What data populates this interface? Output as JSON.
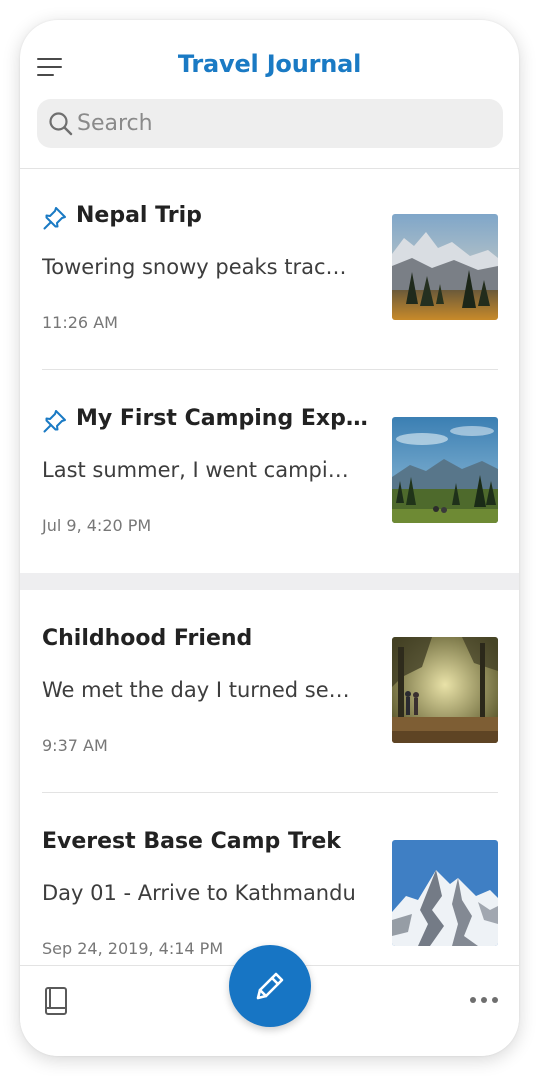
{
  "header": {
    "title": "Travel Journal",
    "search_placeholder": "Search"
  },
  "entries": [
    {
      "title": "Nepal Trip",
      "snippet": "Towering snowy peaks trac…",
      "time": "11:26 AM",
      "pinned": true,
      "thumbnail": "mountain-sunset-forest-image"
    },
    {
      "title": "My First Camping Expe…",
      "snippet": "Last summer, I went campi…",
      "time": "Jul 9, 4:20 PM",
      "pinned": true,
      "thumbnail": "campsite-mountains-image"
    },
    {
      "title": "Childhood Friend",
      "snippet": "We met the day I turned se…",
      "time": "9:37 AM",
      "pinned": false,
      "thumbnail": "forest-path-walkers-image"
    },
    {
      "title": "Everest Base Camp Trek",
      "snippet": "Day 01 - Arrive to Kathmandu",
      "time": "Sep 24, 2019, 4:14 PM",
      "pinned": false,
      "thumbnail": "snowy-everest-peak-image"
    }
  ],
  "toolbar": {
    "left_icon": "notebook-icon",
    "center_icon": "pencil-icon",
    "right_icon": "more-horizontal-icon"
  },
  "colors": {
    "accent": "#1a7ac4",
    "compose_button": "#1775c4",
    "search_background": "#eeeeee",
    "section_separator": "#eeeef0"
  }
}
